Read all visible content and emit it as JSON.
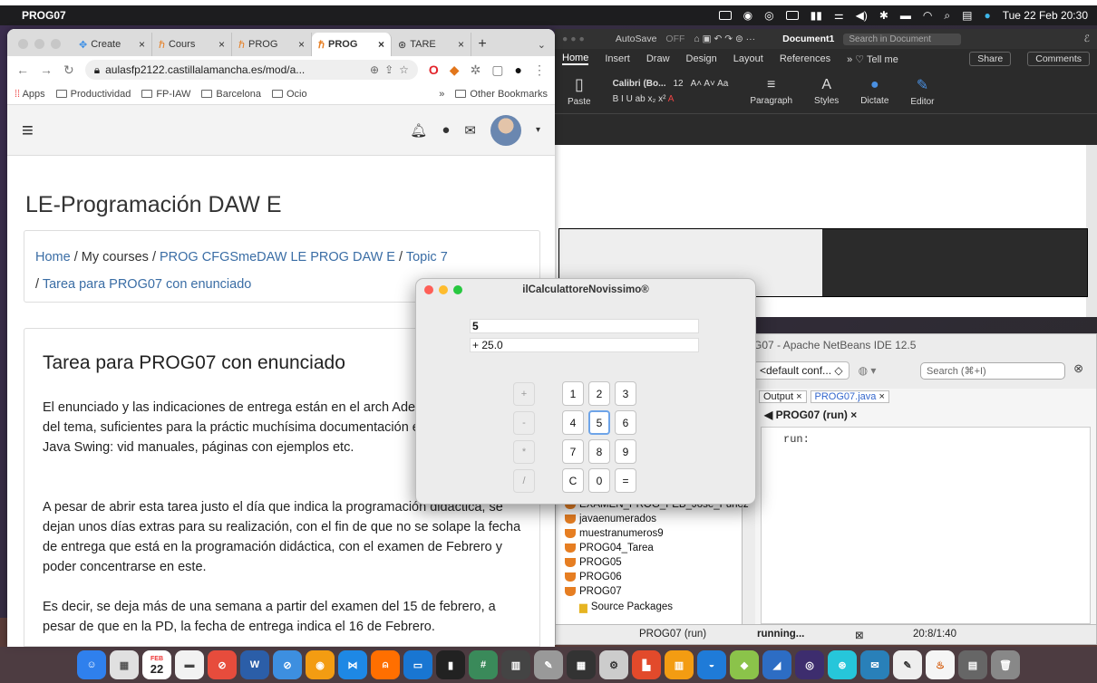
{
  "menubar": {
    "app": "PROG07",
    "datetime": "Tue 22 Feb 20:30"
  },
  "chrome": {
    "tabs": [
      {
        "label": "Create",
        "active": false
      },
      {
        "label": "Cours",
        "active": false
      },
      {
        "label": "PROG",
        "active": false
      },
      {
        "label": "PROG",
        "active": true
      },
      {
        "label": "TARE",
        "active": false
      }
    ],
    "url": "aulasfp2122.castillalamancha.es/mod/a...",
    "bookmarks": [
      "Apps",
      "Productividad",
      "FP-IAW",
      "Barcelona",
      "Ocio"
    ],
    "other_bookmarks": "Other Bookmarks",
    "more_bookmarks": "»"
  },
  "moodle": {
    "page_title": "LE-Programación DAW E",
    "breadcrumb": {
      "home": "Home",
      "sep": "/",
      "my_courses": "My courses",
      "course": "PROG CFGSmeDAW LE PROG DAW E",
      "topic": "Topic 7",
      "task": "Tarea para PROG07 con enunciado"
    },
    "task_heading": "Tarea para PROG07 con enunciado",
    "p1": "El enunciado y las indicaciones de entrega están en el arch Además de los apuntes del tema, suficientes para la práctic muchísima documentación en la web sobre Java Swing: vid manuales, páginas con ejemplos etc.",
    "p2": "A pesar de abrir esta tarea justo el día que indica la programación didáctica, se dejan unos días extras para su realización, con el fin de que no se solape la fecha de entrega que está en la programación didáctica, con el examen de Febrero y poder concentrarse en este.",
    "p3": "Es decir, se deja más de una semana a partir del examen del 15 de febrero, a pesar de que en la  PD, la fecha de entrega  indica el 16 de Febrero."
  },
  "word": {
    "autosave": "AutoSave",
    "autosave_state": "OFF",
    "doc_title": "Document1",
    "search_placeholder": "Search in Document",
    "ribbon_tabs": [
      "Home",
      "Insert",
      "Draw",
      "Design",
      "Layout",
      "References",
      "Tell me"
    ],
    "share": "Share",
    "comments": "Comments",
    "paste": "Paste",
    "font": "Calibri (Bo...",
    "size": "12",
    "groups": [
      "Paragraph",
      "Styles",
      "Dictate",
      "Editor"
    ]
  },
  "netbeans": {
    "title": "G07 - Apache NetBeans IDE 12.5",
    "config": "<default conf...",
    "search_placeholder": "Search (⌘+I)",
    "output_tabs": [
      "Output",
      "PROG07.java"
    ],
    "run_tab": "PROG07 (run)",
    "output_text": "run:",
    "projects": [
      "EXAMEN_PROG_FEB_Jose_Funez",
      "javaenumerados",
      "muestranumeros9",
      "PROG04_Tarea",
      "PROG05",
      "PROG06",
      "PROG07"
    ],
    "source_packages": "Source Packages",
    "status_run": "PROG07 (run)",
    "status_state": "running...",
    "status_pos": "20:8/1:40"
  },
  "calculator": {
    "title": "ilCalculattoreNovissimo®",
    "display": "5",
    "history": "+ 25.0",
    "ops": [
      "+",
      "-",
      "*",
      "/"
    ],
    "keys": [
      "1",
      "2",
      "3",
      "4",
      "5",
      "6",
      "7",
      "8",
      "9",
      "C",
      "0",
      "="
    ]
  },
  "dock": {
    "calendar_month": "FEB",
    "calendar_day": "22"
  }
}
